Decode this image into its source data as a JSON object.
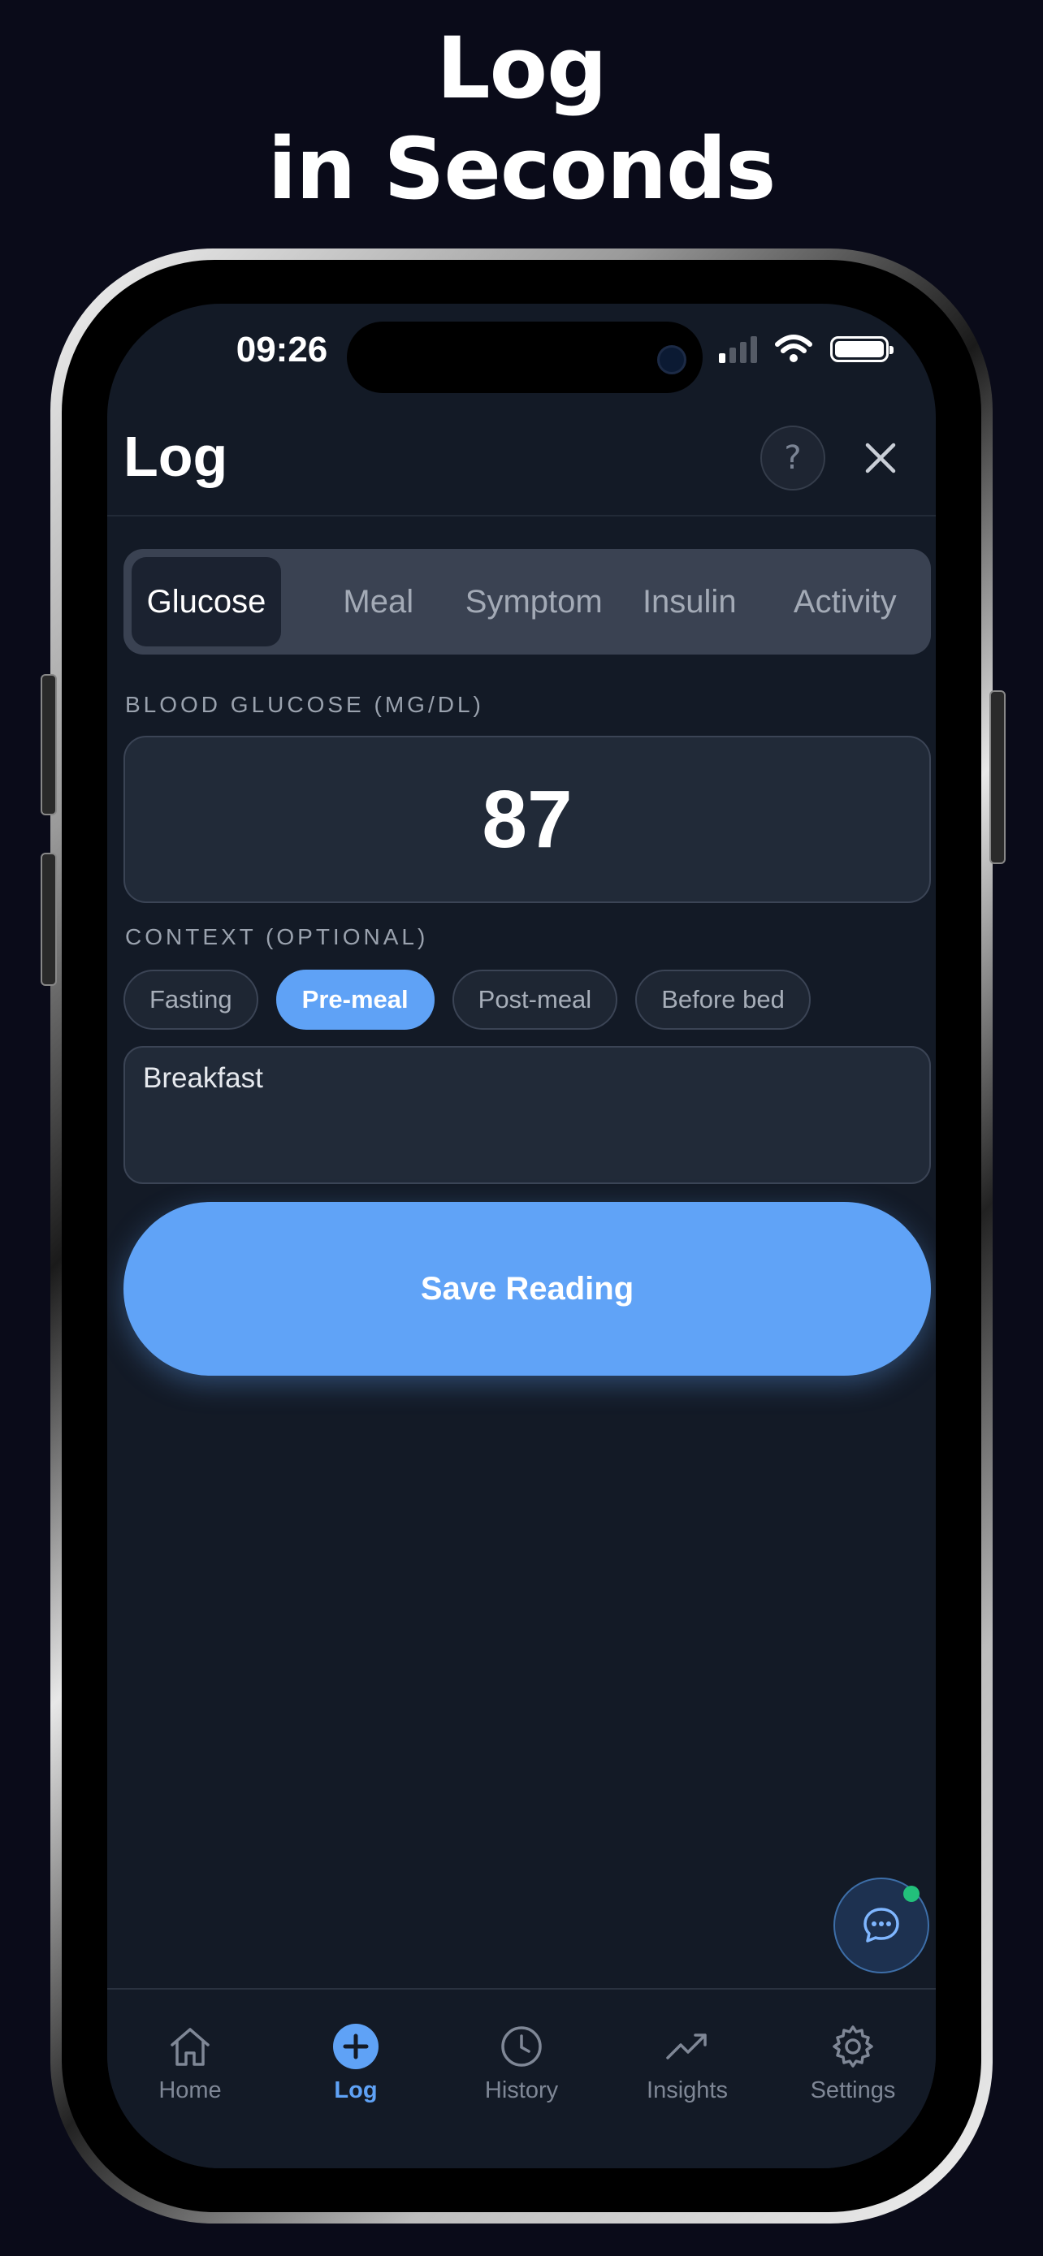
{
  "headline": {
    "line1": "Log",
    "line2": "in Seconds"
  },
  "status_bar": {
    "time": "09:26"
  },
  "header": {
    "title": "Log",
    "help_label": "?"
  },
  "tabs": [
    {
      "label": "Glucose",
      "active": true
    },
    {
      "label": "Meal",
      "active": false
    },
    {
      "label": "Symptom",
      "active": false
    },
    {
      "label": "Insulin",
      "active": false
    },
    {
      "label": "Activity",
      "active": false
    }
  ],
  "glucose": {
    "label": "BLOOD GLUCOSE (MG/DL)",
    "value": "87"
  },
  "context": {
    "label": "CONTEXT (OPTIONAL)",
    "chips": [
      {
        "label": "Fasting",
        "selected": false
      },
      {
        "label": "Pre-meal",
        "selected": true
      },
      {
        "label": "Post-meal",
        "selected": false
      },
      {
        "label": "Before bed",
        "selected": false
      }
    ]
  },
  "note": {
    "value": "Breakfast"
  },
  "save_button": {
    "label": "Save Reading"
  },
  "nav": [
    {
      "label": "Home",
      "icon": "home-icon",
      "active": false
    },
    {
      "label": "Log",
      "icon": "plus-circle-icon",
      "active": true
    },
    {
      "label": "History",
      "icon": "clock-icon",
      "active": false
    },
    {
      "label": "Insights",
      "icon": "trend-icon",
      "active": false
    },
    {
      "label": "Settings",
      "icon": "gear-icon",
      "active": false
    }
  ],
  "colors": {
    "accent": "#60a3f7",
    "background": "#131a26",
    "online_dot": "#22c07b"
  }
}
